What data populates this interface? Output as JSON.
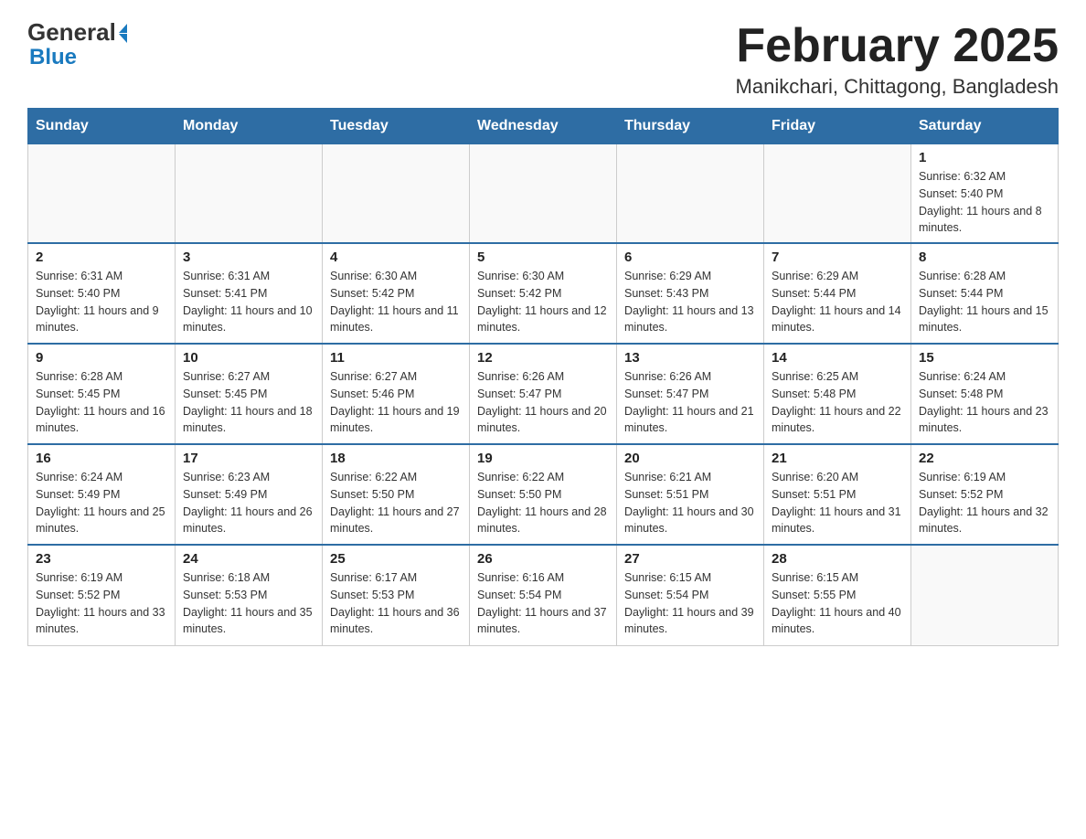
{
  "header": {
    "logo_general": "General",
    "logo_blue": "Blue",
    "month_title": "February 2025",
    "location": "Manikchari, Chittagong, Bangladesh"
  },
  "weekdays": [
    "Sunday",
    "Monday",
    "Tuesday",
    "Wednesday",
    "Thursday",
    "Friday",
    "Saturday"
  ],
  "weeks": [
    {
      "days": [
        {
          "number": "",
          "info": ""
        },
        {
          "number": "",
          "info": ""
        },
        {
          "number": "",
          "info": ""
        },
        {
          "number": "",
          "info": ""
        },
        {
          "number": "",
          "info": ""
        },
        {
          "number": "",
          "info": ""
        },
        {
          "number": "1",
          "info": "Sunrise: 6:32 AM\nSunset: 5:40 PM\nDaylight: 11 hours and 8 minutes."
        }
      ]
    },
    {
      "days": [
        {
          "number": "2",
          "info": "Sunrise: 6:31 AM\nSunset: 5:40 PM\nDaylight: 11 hours and 9 minutes."
        },
        {
          "number": "3",
          "info": "Sunrise: 6:31 AM\nSunset: 5:41 PM\nDaylight: 11 hours and 10 minutes."
        },
        {
          "number": "4",
          "info": "Sunrise: 6:30 AM\nSunset: 5:42 PM\nDaylight: 11 hours and 11 minutes."
        },
        {
          "number": "5",
          "info": "Sunrise: 6:30 AM\nSunset: 5:42 PM\nDaylight: 11 hours and 12 minutes."
        },
        {
          "number": "6",
          "info": "Sunrise: 6:29 AM\nSunset: 5:43 PM\nDaylight: 11 hours and 13 minutes."
        },
        {
          "number": "7",
          "info": "Sunrise: 6:29 AM\nSunset: 5:44 PM\nDaylight: 11 hours and 14 minutes."
        },
        {
          "number": "8",
          "info": "Sunrise: 6:28 AM\nSunset: 5:44 PM\nDaylight: 11 hours and 15 minutes."
        }
      ]
    },
    {
      "days": [
        {
          "number": "9",
          "info": "Sunrise: 6:28 AM\nSunset: 5:45 PM\nDaylight: 11 hours and 16 minutes."
        },
        {
          "number": "10",
          "info": "Sunrise: 6:27 AM\nSunset: 5:45 PM\nDaylight: 11 hours and 18 minutes."
        },
        {
          "number": "11",
          "info": "Sunrise: 6:27 AM\nSunset: 5:46 PM\nDaylight: 11 hours and 19 minutes."
        },
        {
          "number": "12",
          "info": "Sunrise: 6:26 AM\nSunset: 5:47 PM\nDaylight: 11 hours and 20 minutes."
        },
        {
          "number": "13",
          "info": "Sunrise: 6:26 AM\nSunset: 5:47 PM\nDaylight: 11 hours and 21 minutes."
        },
        {
          "number": "14",
          "info": "Sunrise: 6:25 AM\nSunset: 5:48 PM\nDaylight: 11 hours and 22 minutes."
        },
        {
          "number": "15",
          "info": "Sunrise: 6:24 AM\nSunset: 5:48 PM\nDaylight: 11 hours and 23 minutes."
        }
      ]
    },
    {
      "days": [
        {
          "number": "16",
          "info": "Sunrise: 6:24 AM\nSunset: 5:49 PM\nDaylight: 11 hours and 25 minutes."
        },
        {
          "number": "17",
          "info": "Sunrise: 6:23 AM\nSunset: 5:49 PM\nDaylight: 11 hours and 26 minutes."
        },
        {
          "number": "18",
          "info": "Sunrise: 6:22 AM\nSunset: 5:50 PM\nDaylight: 11 hours and 27 minutes."
        },
        {
          "number": "19",
          "info": "Sunrise: 6:22 AM\nSunset: 5:50 PM\nDaylight: 11 hours and 28 minutes."
        },
        {
          "number": "20",
          "info": "Sunrise: 6:21 AM\nSunset: 5:51 PM\nDaylight: 11 hours and 30 minutes."
        },
        {
          "number": "21",
          "info": "Sunrise: 6:20 AM\nSunset: 5:51 PM\nDaylight: 11 hours and 31 minutes."
        },
        {
          "number": "22",
          "info": "Sunrise: 6:19 AM\nSunset: 5:52 PM\nDaylight: 11 hours and 32 minutes."
        }
      ]
    },
    {
      "days": [
        {
          "number": "23",
          "info": "Sunrise: 6:19 AM\nSunset: 5:52 PM\nDaylight: 11 hours and 33 minutes."
        },
        {
          "number": "24",
          "info": "Sunrise: 6:18 AM\nSunset: 5:53 PM\nDaylight: 11 hours and 35 minutes."
        },
        {
          "number": "25",
          "info": "Sunrise: 6:17 AM\nSunset: 5:53 PM\nDaylight: 11 hours and 36 minutes."
        },
        {
          "number": "26",
          "info": "Sunrise: 6:16 AM\nSunset: 5:54 PM\nDaylight: 11 hours and 37 minutes."
        },
        {
          "number": "27",
          "info": "Sunrise: 6:15 AM\nSunset: 5:54 PM\nDaylight: 11 hours and 39 minutes."
        },
        {
          "number": "28",
          "info": "Sunrise: 6:15 AM\nSunset: 5:55 PM\nDaylight: 11 hours and 40 minutes."
        },
        {
          "number": "",
          "info": ""
        }
      ]
    }
  ]
}
